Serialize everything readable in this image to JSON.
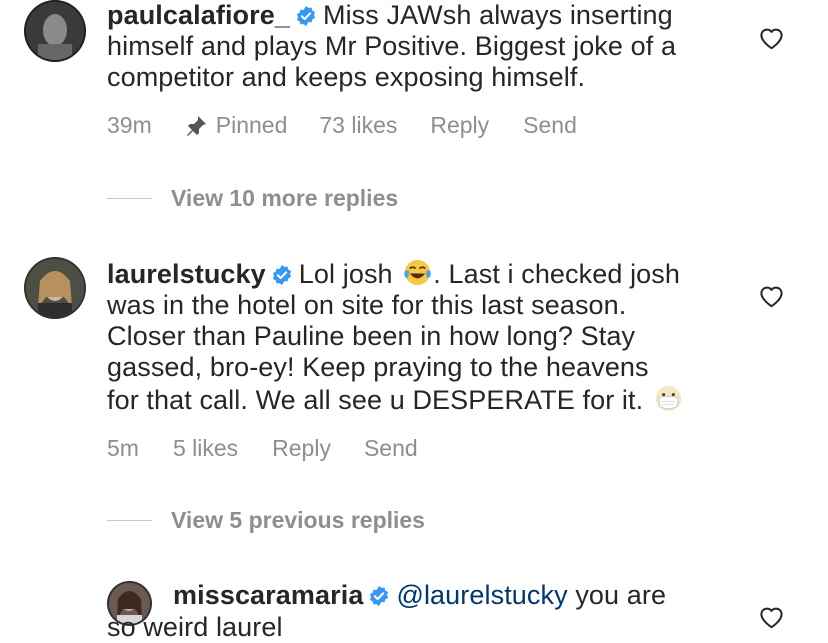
{
  "comments": [
    {
      "username": "paulcalafiore_",
      "text_line1": "Miss JAWsh always inserting",
      "text_line2": "himself and plays Mr Positive. Biggest joke of a",
      "text_line3": "competitor and keeps exposing himself.",
      "time": "39m",
      "pinned_label": "Pinned",
      "likes": "73 likes",
      "reply": "Reply",
      "send": "Send",
      "view_replies": "View 10 more replies"
    },
    {
      "username": "laurelstucky",
      "text_line1a": "Lol josh",
      "text_line1b": ". Last i checked josh",
      "text_line2": "was in the hotel on site for this last season.",
      "text_line3": "Closer than Pauline been in how long? Stay",
      "text_line4": "gassed, bro-ey! Keep praying to the heavens",
      "text_line5": "for that call. We all see u DESPERATE for it.",
      "time": "5m",
      "likes": "5 likes",
      "reply": "Reply",
      "send": "Send",
      "view_replies": "View 5 previous replies"
    },
    {
      "username": "misscaramaria",
      "mention": "@laurelstucky",
      "text_line1": "you are",
      "text_line2": "so weird laurel"
    }
  ],
  "icons": {
    "verified": "verified-badge-icon",
    "heart": "heart-outline-icon",
    "pin": "pin-icon",
    "laugh_emoji": "tears-of-joy-emoji",
    "mask_emoji": "face-with-medical-mask-emoji"
  },
  "colors": {
    "verified_blue": "#3897f0",
    "meta_gray": "#8e8e8e",
    "mention_blue": "#00376b"
  }
}
